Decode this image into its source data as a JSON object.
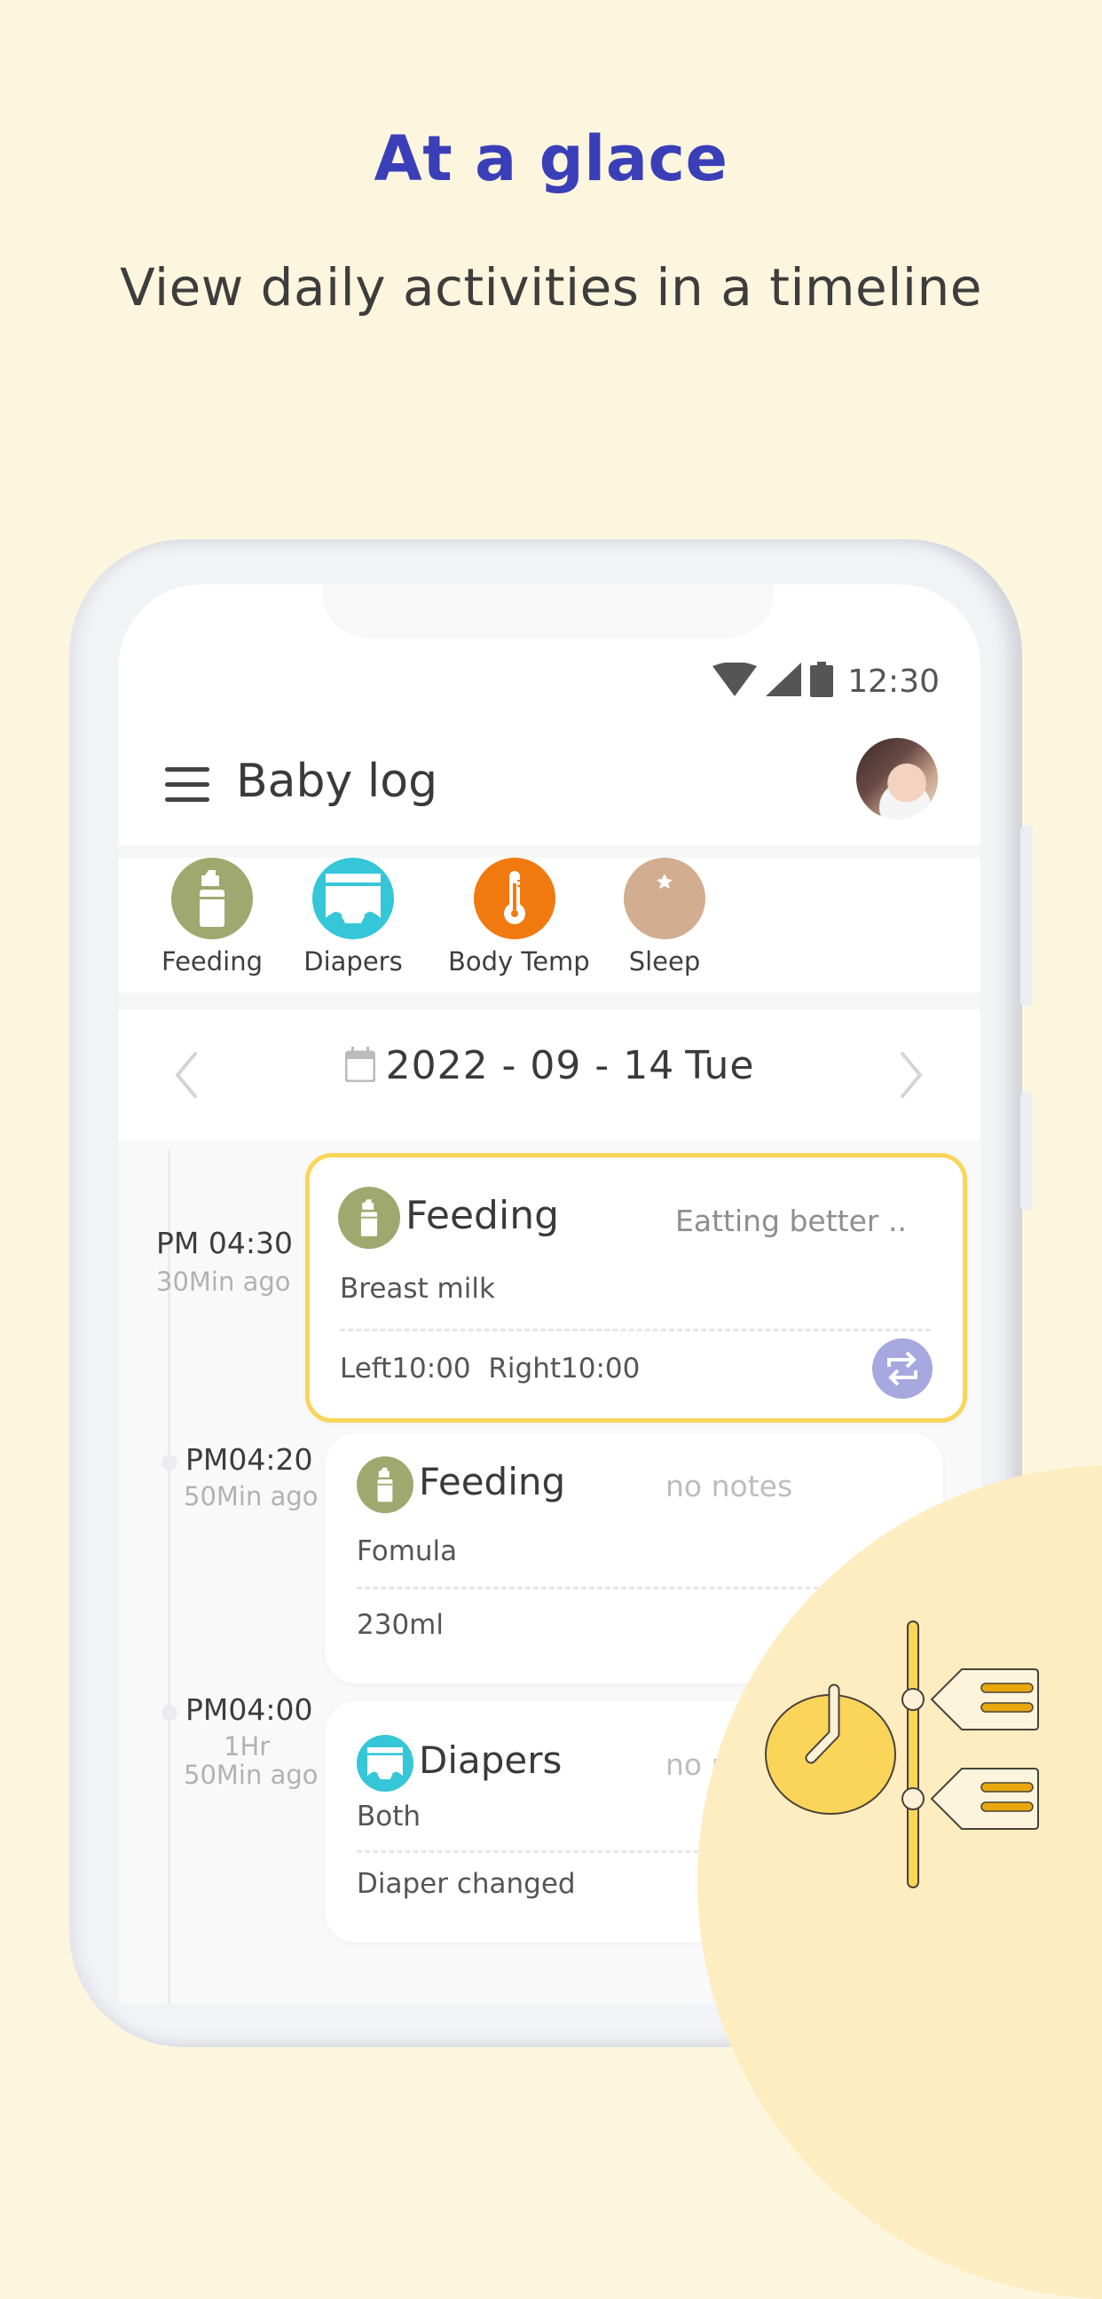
{
  "promo": {
    "headline": "At a glace",
    "subheadline": "View daily activities in a timeline"
  },
  "status_bar": {
    "time": "12:30",
    "icons": [
      "wifi-icon",
      "signal-icon",
      "battery-icon"
    ]
  },
  "app_bar": {
    "title": "Baby log",
    "menu_icon": "hamburger-menu-icon",
    "avatar": "baby-profile-avatar"
  },
  "categories": [
    {
      "label": "Feeding",
      "icon": "baby-bottle-icon",
      "color": "#9fa86e"
    },
    {
      "label": "Diapers",
      "icon": "diaper-icon",
      "color": "#35c6d8"
    },
    {
      "label": "Body Temp",
      "icon": "thermometer-icon",
      "color": "#f07a10"
    },
    {
      "label": "Sleep",
      "icon": "moon-star-icon",
      "color": "#d2ad8f"
    }
  ],
  "date_nav": {
    "date": "2022 - 09 - 14",
    "weekday": "Tue",
    "prev_icon": "chevron-left-icon",
    "next_icon": "chevron-right-icon",
    "calendar_icon": "calendar-icon"
  },
  "timeline": [
    {
      "time": "PM 04:30",
      "ago": "30Min ago",
      "type": "Feeding",
      "icon": "baby-bottle-icon",
      "note": "Eatting better ..",
      "detail": "Breast milk",
      "summary": "Left10:00  Right10:00",
      "highlighted": true,
      "action_icon": "swap-arrows-icon"
    },
    {
      "time": "PM04:20",
      "ago": "50Min ago",
      "type": "Feeding",
      "icon": "baby-bottle-icon",
      "note": "no notes",
      "detail": "Fomula",
      "summary": "230ml",
      "highlighted": false
    },
    {
      "time": "PM04:00",
      "ago_line1": "1Hr",
      "ago_line2": "50Min ago",
      "type": "Diapers",
      "icon": "diaper-icon",
      "note": "no notes",
      "detail": "Both",
      "summary": "Diaper changed",
      "highlighted": false
    }
  ],
  "colors": {
    "background": "#fdf6df",
    "headline": "#3a3fb8",
    "highlight_border": "#f9d65a",
    "swap_button": "#a7a8e0",
    "feeding": "#9fa86e",
    "diapers": "#35c6d8",
    "body_temp": "#f07a10",
    "sleep": "#d2ad8f"
  },
  "decoration": {
    "illustration": "timeline-clock-illustration"
  }
}
